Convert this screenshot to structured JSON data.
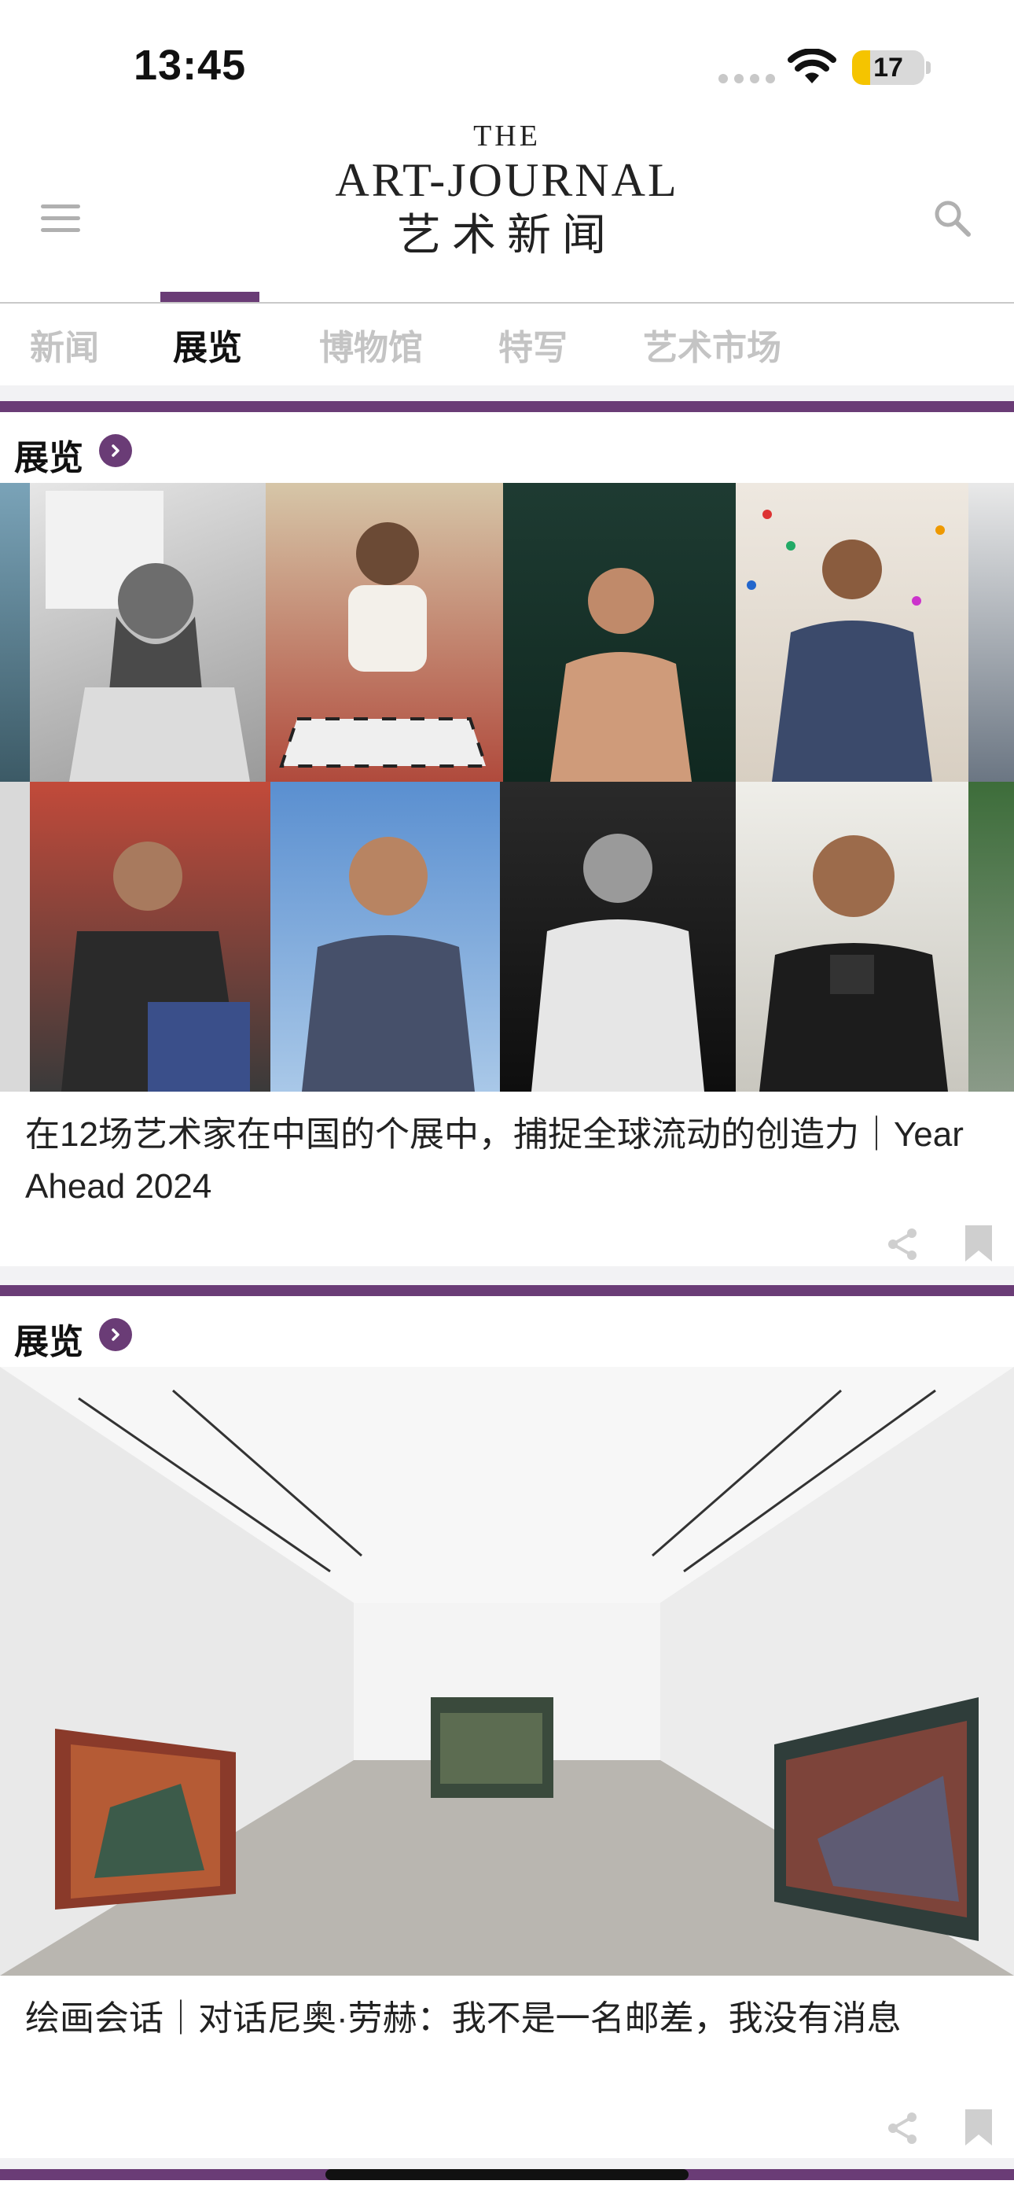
{
  "status_bar": {
    "time": "13:45",
    "battery_level": "17",
    "battery_fraction": 0.17
  },
  "header": {
    "logo_the": "THE",
    "logo_main": "ART-JOURNAL",
    "logo_cn": "艺术新闻",
    "menu_icon": "hamburger-menu-icon",
    "search_icon": "search-icon"
  },
  "tabs": [
    {
      "label": "新闻",
      "active": false
    },
    {
      "label": "展览",
      "active": true
    },
    {
      "label": "博物馆",
      "active": false
    },
    {
      "label": "特写",
      "active": false
    },
    {
      "label": "艺术市场",
      "active": false
    }
  ],
  "articles": [
    {
      "section": "展览",
      "title": "在12场艺术家在中国的个展中，捕捉全球流动的创造力｜Year Ahead 2024",
      "image": "portrait-collage"
    },
    {
      "section": "展览",
      "title": "绘画会话｜对话尼奥·劳赫：我不是一名邮差，我没有消息",
      "image": "gallery-installation-view"
    }
  ],
  "colors": {
    "accent": "#6a3c76",
    "battery": "#f5c400",
    "inactive_tab": "#c4c4c4"
  }
}
